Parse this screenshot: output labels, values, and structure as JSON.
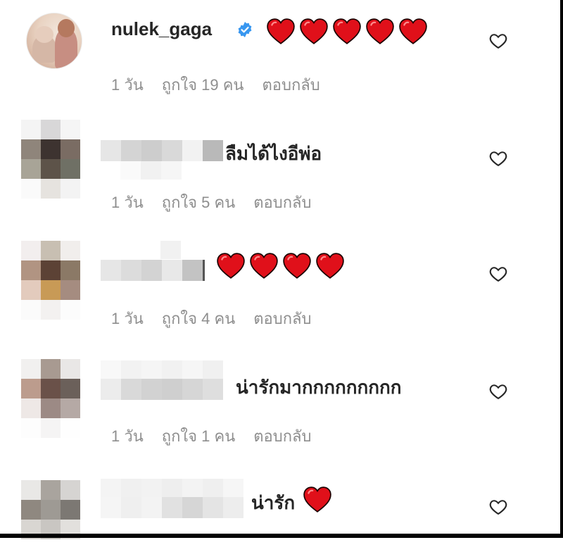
{
  "comments": [
    {
      "username": "nulek_gaga",
      "verified": true,
      "text": "",
      "hearts": 5,
      "time": "1 วัน",
      "likes": "ถูกใจ 19 คน",
      "reply": "ตอบกลับ"
    },
    {
      "username": "",
      "text": "ลืมได้ไงอีพ่อ",
      "hearts": 0,
      "time": "1 วัน",
      "likes": "ถูกใจ 5 คน",
      "reply": "ตอบกลับ"
    },
    {
      "username": "",
      "text": "",
      "hearts": 4,
      "time": "1 วัน",
      "likes": "ถูกใจ 4 คน",
      "reply": "ตอบกลับ"
    },
    {
      "username": "",
      "text": "น่ารักมากกกกกกกกก",
      "hearts": 0,
      "time": "1 วัน",
      "likes": "ถูกใจ 1 คน",
      "reply": "ตอบกลับ"
    },
    {
      "username": "",
      "text": "น่ารัก",
      "hearts": 1,
      "time": "",
      "likes": "",
      "reply": ""
    }
  ],
  "colors": {
    "heart": "#e0101a",
    "verified": "#3897f0",
    "meta": "#8e8e8e"
  },
  "icons": {
    "like": "heart-outline-icon",
    "verified": "verified-badge-icon",
    "emoji": "red-heart-emoji"
  }
}
